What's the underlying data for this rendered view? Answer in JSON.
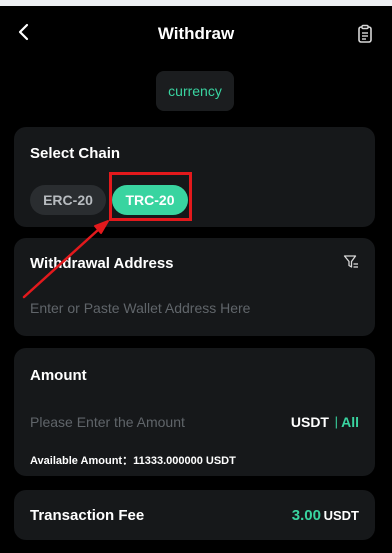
{
  "header": {
    "title": "Withdraw"
  },
  "currency": {
    "label": "currency"
  },
  "chain": {
    "title": "Select Chain",
    "options": [
      "ERC-20",
      "TRC-20"
    ],
    "selected": "TRC-20"
  },
  "address": {
    "title": "Withdrawal Address",
    "placeholder": "Enter or Paste Wallet Address Here"
  },
  "amount": {
    "title": "Amount",
    "placeholder": "Please Enter the Amount",
    "unit": "USDT",
    "separator": "|",
    "all_label": "All",
    "available_label": "Available Amount：",
    "available_value": "11333.000000 USDT"
  },
  "fee": {
    "title": "Transaction Fee",
    "value": "3.00",
    "unit": "USDT"
  },
  "colors": {
    "accent": "#39d4a0",
    "background": "#000000",
    "card": "#16181a",
    "highlight": "#e3191c"
  },
  "icons": [
    "back-arrow-icon",
    "document-icon",
    "filter-icon"
  ]
}
